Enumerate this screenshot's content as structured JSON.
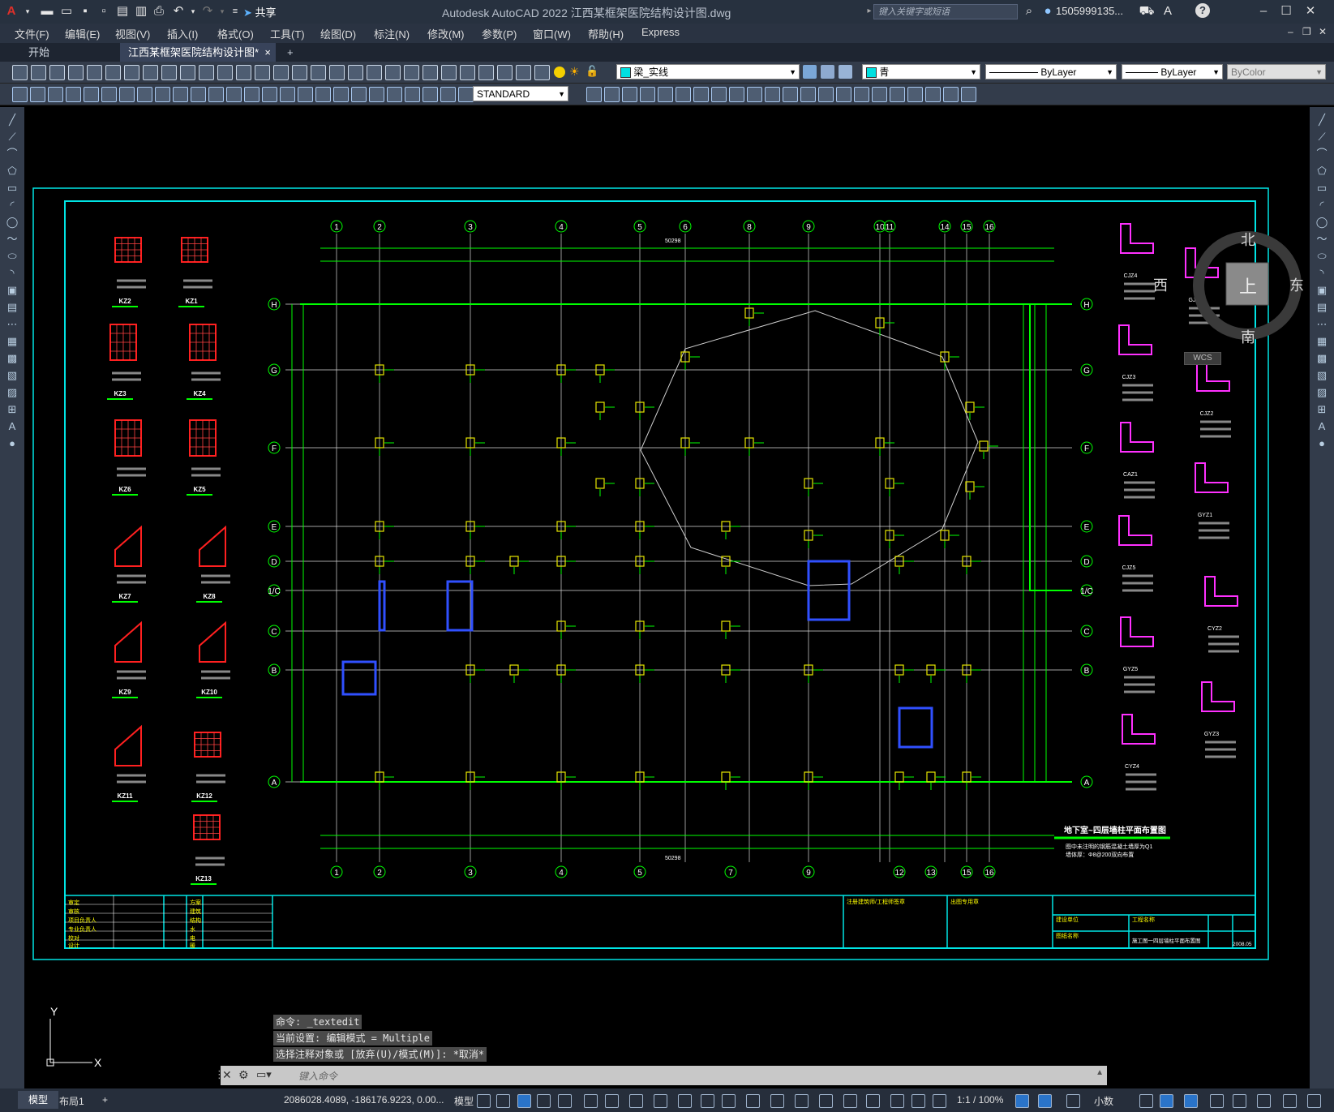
{
  "titlebar": {
    "app_title": "Autodesk AutoCAD 2022    江西某框架医院结构设计图.dwg",
    "share_label": "共享",
    "search_placeholder": "键入关键字或短语",
    "user_name": "1505999135...",
    "help_icon": "?"
  },
  "menubar": {
    "items": [
      "文件(F)",
      "编辑(E)",
      "视图(V)",
      "插入(I)",
      "格式(O)",
      "工具(T)",
      "绘图(D)",
      "标注(N)",
      "修改(M)",
      "参数(P)",
      "窗口(W)",
      "帮助(H)",
      "Express"
    ]
  },
  "tabs": {
    "start_label": "开始",
    "active_label": "江西某框架医院结构设计图*",
    "close_glyph": "×",
    "add_glyph": "+"
  },
  "toolbar": {
    "layer_name": "梁_实线",
    "color_value": "青",
    "linetype_value": "ByLayer",
    "lineweight_value": "ByLayer",
    "plotstyle_value": "ByColor",
    "text_style": "STANDARD"
  },
  "viewcube": {
    "north": "北",
    "south": "南",
    "east": "东",
    "west": "西",
    "top": "上",
    "wcs_label": "WCS"
  },
  "drawing": {
    "plan_title": "地下室~四层墙柱平面布置图",
    "note_line1": "图中未注明的钢筋混凝土墙厚为Q1",
    "note_line2": "墙体厚：Φ8@200双向布置",
    "top_axes": [
      "1",
      "2",
      "3",
      "4",
      "5",
      "6",
      "8",
      "9",
      "10",
      "11",
      "14",
      "15",
      "16"
    ],
    "bottom_axes": [
      "1",
      "2",
      "3",
      "4",
      "5",
      "7",
      "9",
      "12",
      "13",
      "15",
      "16"
    ],
    "side_axes": [
      "H",
      "G",
      "F",
      "E",
      "D",
      "1/C",
      "C",
      "B",
      "A"
    ],
    "overall_dim": "50298",
    "left_details": [
      "KZ2",
      "KZ1",
      "KZ3",
      "KZ4",
      "KZ6",
      "KZ5",
      "KZ7",
      "KZ8",
      "KZ9",
      "KZ10",
      "KZ11",
      "KZ12",
      "KZ13"
    ],
    "right_details": [
      "CJZ4",
      "GJZ1",
      "CJZ3",
      "CJZ2",
      "CAZ1",
      "GYZ1",
      "CJZ5",
      "CYZ2",
      "GYZ5",
      "GYZ3",
      "CYZ4"
    ],
    "title_block": {
      "row_labels": [
        "审定",
        "审核",
        "项目负责人",
        "专业负责人",
        "校对",
        "设计"
      ],
      "disc_labels": [
        "方案",
        "建筑",
        "结构",
        "水",
        "电",
        "暖"
      ],
      "cert_label": "出图专用章",
      "approval_label": "注册建筑师/工程师签章",
      "client_label": "建设单位",
      "project_label": "工程名称",
      "drawing_label": "图纸名称",
      "drawing_name": "施工图一四层墙柱平面布置图",
      "date_value": "2008.05"
    }
  },
  "command": {
    "history": [
      "命令: _textedit",
      "当前设置: 编辑模式 = Multiple",
      "选择注释对象或 [放弃(U)/模式(M)]: *取消*"
    ],
    "input_placeholder": "键入命令"
  },
  "ucs": {
    "x_label": "X",
    "y_label": "Y"
  },
  "statusbar": {
    "model_tab": "模型",
    "layout_tab": "布局1",
    "add_tab": "+",
    "coordinates": "2086028.4089, -186176.9223, 0.00...",
    "space_label": "模型",
    "scale_label": "1:1 / 100%",
    "units_label": "小数"
  }
}
